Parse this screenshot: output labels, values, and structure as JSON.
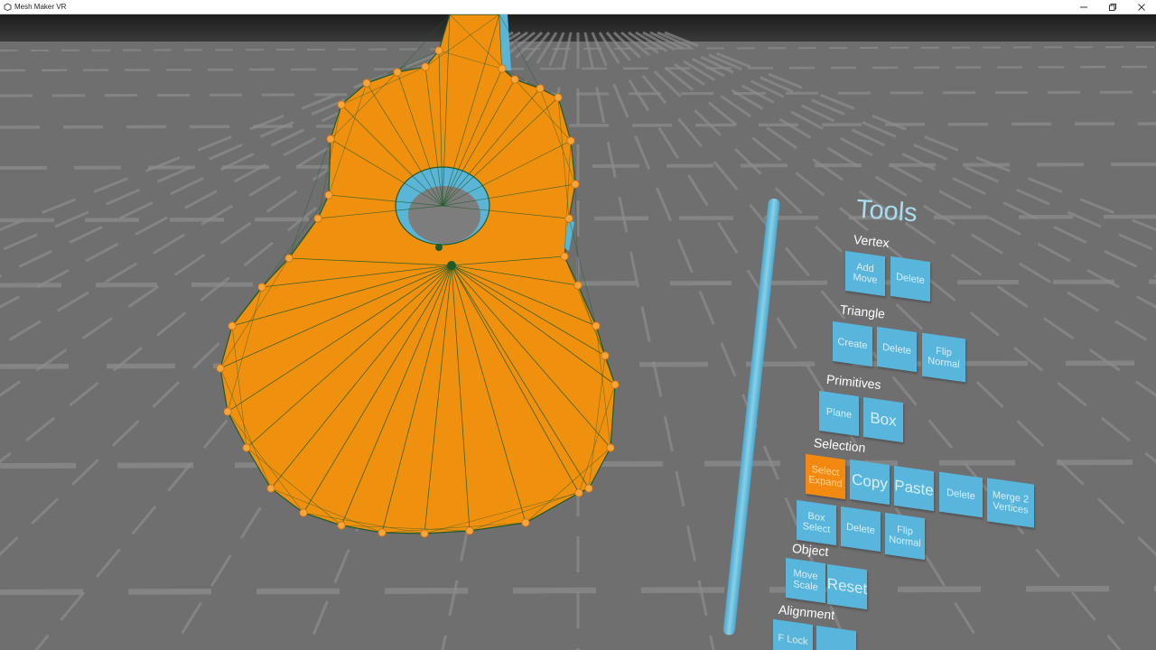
{
  "window": {
    "title": "Mesh Maker VR"
  },
  "colors": {
    "mesh": "#f0900f",
    "vertex": "#f5a53a",
    "edge": "#1f5a2a",
    "inner": "#5ab5d6",
    "button": "#58b6dc",
    "button_active": "#f28a12",
    "floor": "#6f6f6f"
  },
  "tools": {
    "title": "Tools",
    "vertex": {
      "label": "Vertex",
      "buttons": [
        "Add Move",
        "Delete"
      ]
    },
    "triangle": {
      "label": "Triangle",
      "buttons": [
        "Create",
        "Delete",
        "Flip Normal"
      ]
    },
    "primitives": {
      "label": "Primitives",
      "buttons": [
        "Plane",
        "Box"
      ]
    },
    "selection": {
      "label": "Selection",
      "buttons": [
        "Select Expand",
        "Copy",
        "Paste",
        "Delete",
        "Merge 2 Vertices",
        "Box Select",
        "Delete",
        "Flip Normal"
      ],
      "active": "Select Expand"
    },
    "object": {
      "label": "Object",
      "buttons": [
        "Move Scale",
        "Reset"
      ]
    },
    "alignment": {
      "label": "Alignment",
      "buttons": [
        "F Lock"
      ]
    }
  }
}
